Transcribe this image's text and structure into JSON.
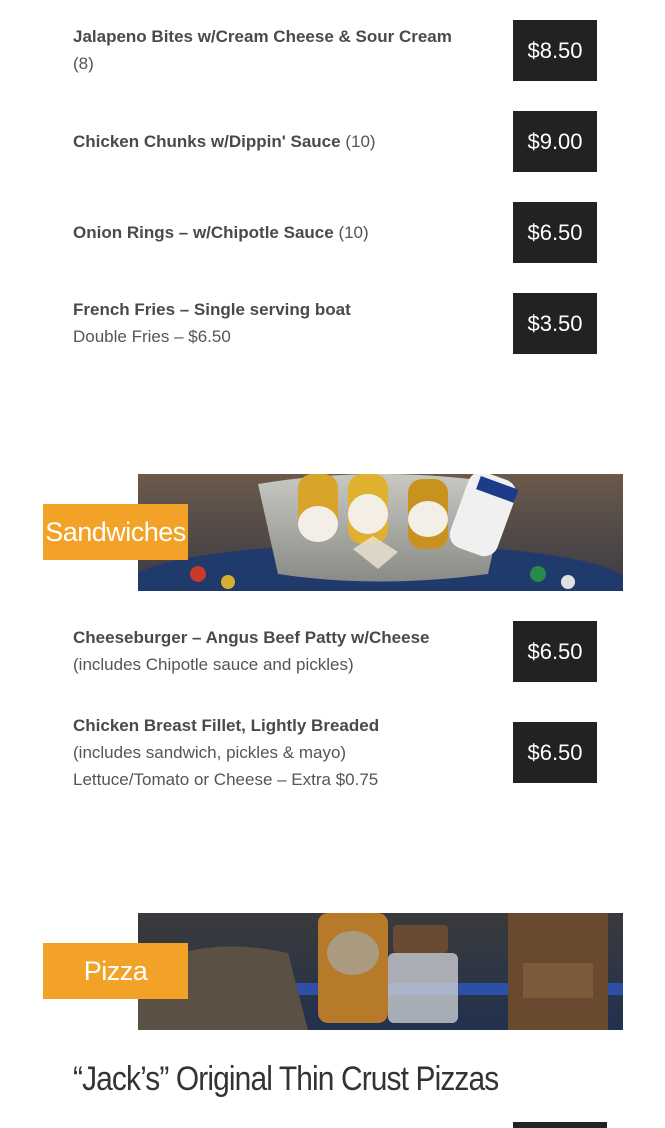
{
  "sides": [
    {
      "name": "Jalapeno Bites w/Cream Cheese & Sour Cream",
      "qty": "(8)",
      "desc": "",
      "price": "$8.50"
    },
    {
      "name": "Chicken Chunks w/Dippin' Sauce",
      "qty": "(10)",
      "desc": "",
      "price": "$9.00"
    },
    {
      "name": "Onion Rings – w/Chipotle Sauce",
      "qty": "(10)",
      "desc": "",
      "price": "$6.50"
    },
    {
      "name": "French Fries – Single serving boat",
      "qty": "",
      "desc": "Double Fries – $6.50",
      "price": "$3.50"
    }
  ],
  "sandwiches": {
    "label": "Sandwiches",
    "items": [
      {
        "name": "Cheeseburger – Angus Beef Patty w/Cheese",
        "desc": "(includes Chipotle sauce and pickles)",
        "price": "$6.50"
      },
      {
        "name": "Chicken Breast Fillet, Lightly Breaded",
        "desc": "(includes sandwich, pickles & mayo)",
        "desc2": "Lettuce/Tomato or Cheese – Extra $0.75",
        "price": "$6.50"
      }
    ]
  },
  "pizza": {
    "label": "Pizza",
    "subheading": "“Jack’s” Original Thin Crust Pizzas"
  },
  "colors": {
    "accent": "#f2a227",
    "price_bg": "#222222"
  }
}
